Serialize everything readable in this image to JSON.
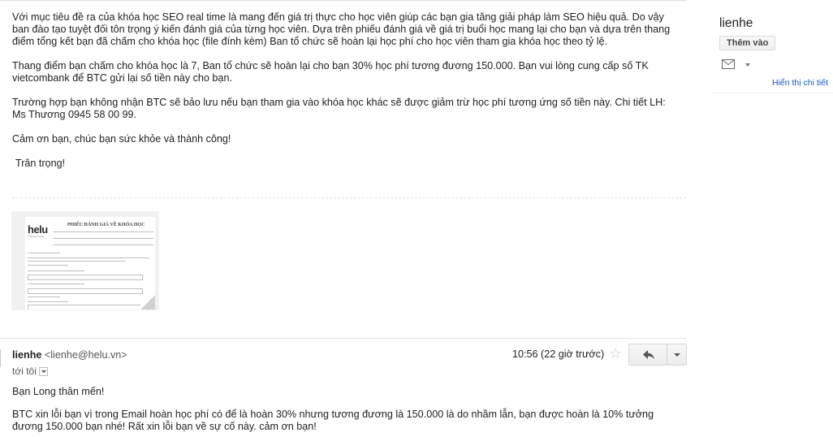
{
  "message": {
    "paragraphs": [
      "Với mục tiêu đề ra của khóa học SEO real time là mang đến giá trị thực cho học viên giúp các bạn gia tăng giải pháp làm SEO hiệu quả. Do vậy ban đào tạo tuyệt đối tôn trọng ý kiến đánh giá của từng học viên. Dựa trên phiếu đánh giá về giá trị buổi học mang lại cho bạn  và dựa trên thang điểm tổng kết bạn đã chấm cho khóa học (file đính kèm)  Ban tổ chức sẽ hoàn lại học phí cho học viên tham gia khóa học theo tỷ lệ.",
      "Thang điểm bạn chấm cho khóa học là 7, Ban tổ chức sẽ hoàn lại cho bạn 30% học phí tương đương 150.000.  Bạn vui lòng cung cấp số TK vietcombank để BTC gửi lại số tiền này cho bạn.",
      "Trường hợp bạn không nhận BTC sẽ bảo lưu nếu bạn tham gia vào khóa học khác sẽ được  giảm trừ học phí tương ứng số tiền này. Chi tiết LH: Ms Thương 0945 58 00 99.",
      "Cảm ơn bạn, chúc bạn sức khỏe và thành công!"
    ],
    "signoff": "Trân trọng!"
  },
  "attachment": {
    "logo_text": "helu",
    "logo_subtext": "Training Center",
    "doc_title": "PHIẾU ĐÁNH GIÁ VỀ KHÓA HỌC"
  },
  "reply": {
    "sender_name": "lienhe",
    "sender_email": "<lienhe@helu.vn>",
    "recipient": "tới tôi",
    "timestamp": "10:56 (22 giờ trước)",
    "paragraphs": [
      "Bạn Long thân mến!",
      "BTC xin lỗi bạn vì trong Email hoàn học phí có để là hoàn 30% nhưng tương đương là 150.000 là do nhầm lẫn, bạn được hoàn là 10% tưởng đương 150.000 bạn nhé!  Rất xin lỗi bạn về sự cố này. cảm ơn bạn!"
    ]
  },
  "sidebar": {
    "contact_name": "lienhe",
    "add_button_label": "Thêm vào",
    "details_link": "Hiển thị chi tiết"
  },
  "icons": {
    "star": "star-icon",
    "reply": "reply-icon",
    "more": "chevron-down-icon",
    "mail": "mail-icon"
  }
}
